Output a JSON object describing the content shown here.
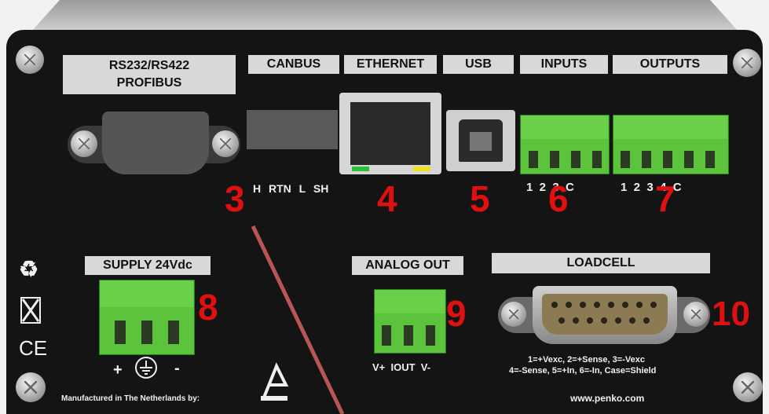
{
  "panel": {
    "header_labels": {
      "rs232": "RS232/RS422",
      "profibus": "PROFIBUS",
      "canbus": "CANBUS",
      "ethernet": "ETHERNET",
      "usb": "USB",
      "inputs": "INPUTS",
      "outputs": "OUTPUTS"
    },
    "canbus_pins": "H RTN L SH",
    "inputs_pins": "1  2  3  C",
    "outputs_pins": "1  2  3  4  C",
    "numbers": {
      "n3": "3",
      "n4": "4",
      "n5": "5",
      "n6": "6",
      "n7": "7",
      "n8": "8",
      "n9": "9",
      "n10": "10"
    },
    "supply_label": "SUPPLY 24Vdc",
    "supply_plus": "+",
    "supply_minus": "-",
    "analog_label": "ANALOG OUT",
    "analog_pins": "V+  IOUT  V-",
    "loadcell_label": "LOADCELL",
    "loadcell_line1": "1=+Vexc, 2=+Sense, 3=-Vexc",
    "loadcell_line2": "4=-Sense, 5=+In, 6=-In, Case=Shield",
    "manufactured": "Manufactured in The Netherlands by:",
    "website": "www.penko.com",
    "ce_mark": "CE"
  },
  "colors": {
    "panel": "#141414",
    "label_bg": "#d8d8d8",
    "terminal_green": "#5cc43c",
    "callout_red": "#e01010",
    "pointer_line": "#b85555"
  }
}
